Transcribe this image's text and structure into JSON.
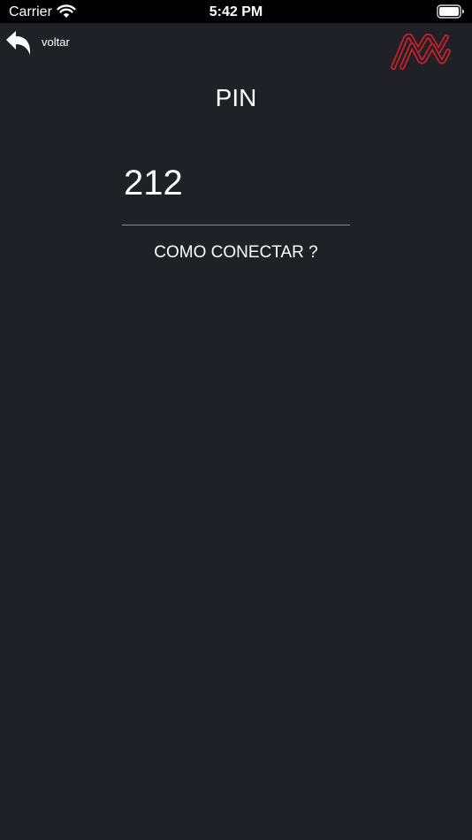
{
  "status_bar": {
    "carrier": "Carrier",
    "time": "5:42 PM",
    "icons": [
      "wifi-icon",
      "battery-icon"
    ]
  },
  "nav": {
    "back_label": "voltar",
    "back_icon": "back-arrow-icon",
    "logo_icon": "brand-logo-icon",
    "logo_color": "#c8202a"
  },
  "main": {
    "title": "PIN",
    "pin_value": "212",
    "help_link": "COMO CONECTAR ?"
  },
  "colors": {
    "background": "#202127",
    "text": "#ffffff",
    "underline": "#8a8b90"
  }
}
